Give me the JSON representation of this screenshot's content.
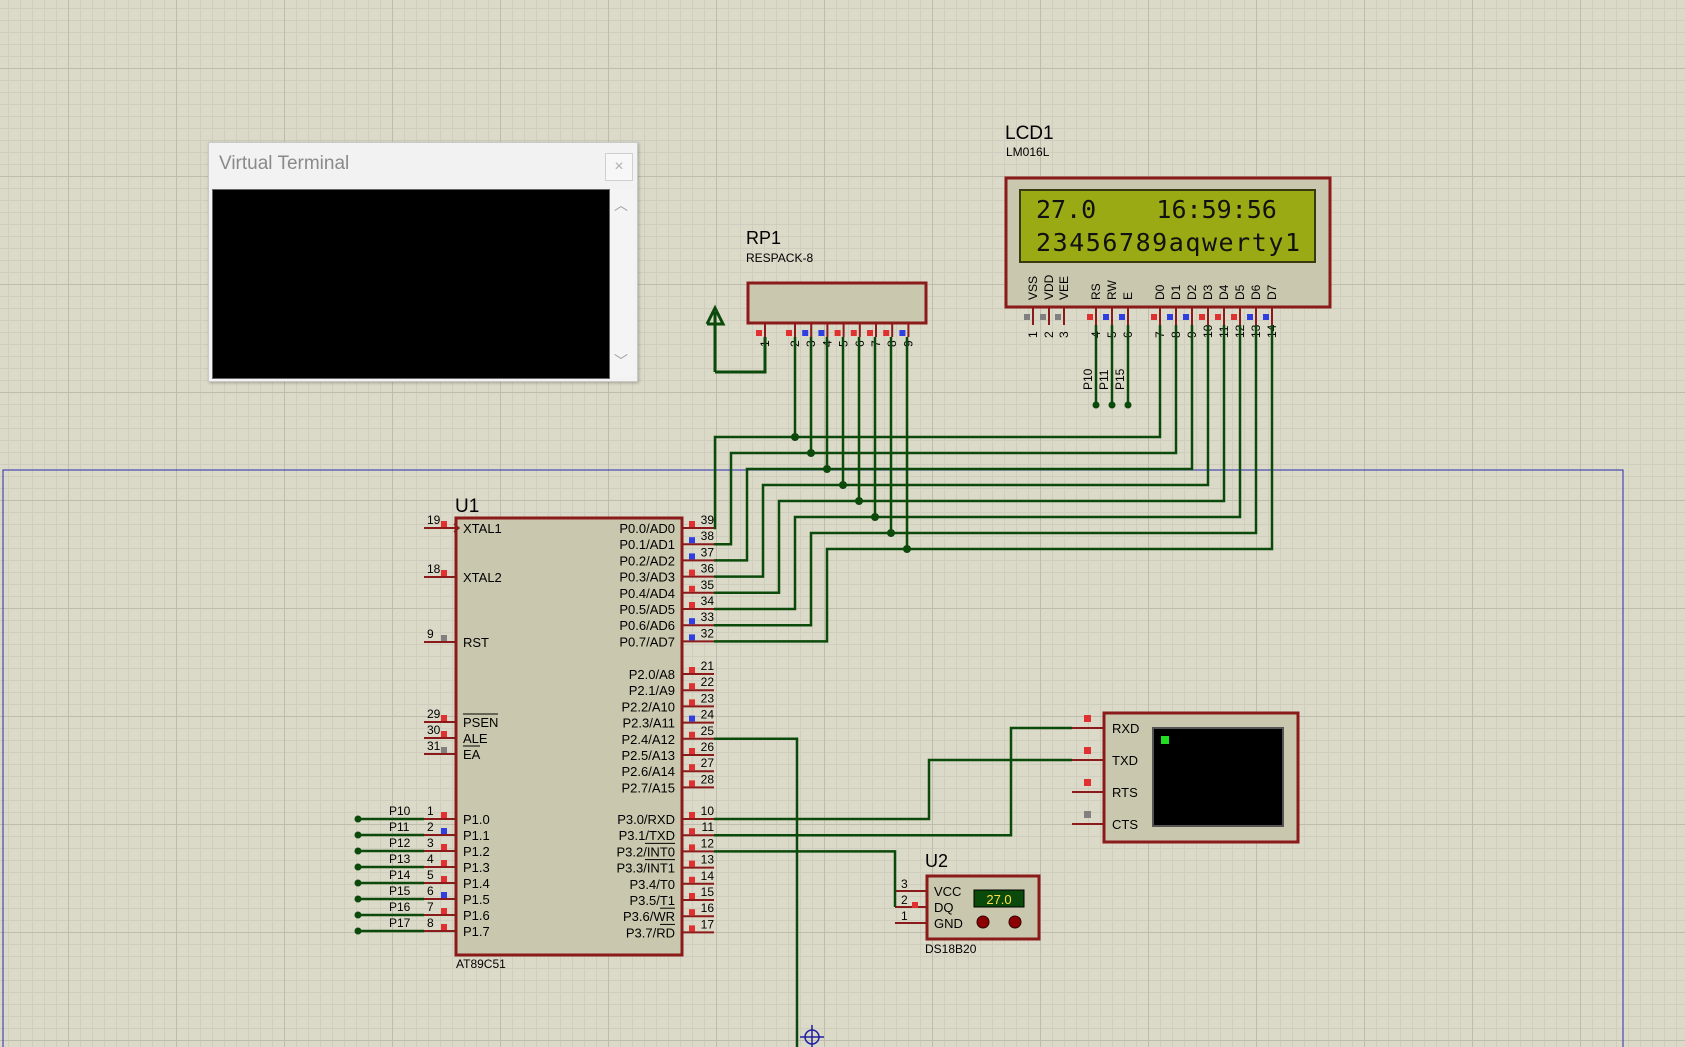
{
  "terminal_window": {
    "title": "Virtual Terminal",
    "close": "×",
    "scroll_up": "︿",
    "scroll_down": "﹀"
  },
  "lcd": {
    "ref": "LCD1",
    "part": "LM016L",
    "line1": "27.0    16:59:56",
    "line2": "23456789aqwerty1",
    "pins": [
      "VSS",
      "VDD",
      "VEE",
      "RS",
      "RW",
      "E",
      "D0",
      "D1",
      "D2",
      "D3",
      "D4",
      "D5",
      "D6",
      "D7"
    ],
    "pin_numbers": [
      "1",
      "2",
      "3",
      "4",
      "5",
      "6",
      "7",
      "8",
      "9",
      "10",
      "11",
      "12",
      "13",
      "14"
    ],
    "ctrl_nets": [
      "P10",
      "P11",
      "P15"
    ]
  },
  "rp1": {
    "ref": "RP1",
    "part": "RESPACK-8",
    "pin_numbers": [
      "1",
      "2",
      "3",
      "4",
      "5",
      "6",
      "7",
      "8",
      "9"
    ]
  },
  "u1": {
    "ref": "U1",
    "part": "AT89C51",
    "left_pins": [
      {
        "num": "19",
        "name": "XTAL1"
      },
      {
        "num": "18",
        "name": "XTAL2"
      },
      {
        "num": "9",
        "name": "RST"
      },
      {
        "num": "29",
        "name": "PSEN"
      },
      {
        "num": "30",
        "name": "ALE"
      },
      {
        "num": "31",
        "name": "EA"
      },
      {
        "num": "1",
        "name": "P1.0",
        "net": "P10"
      },
      {
        "num": "2",
        "name": "P1.1",
        "net": "P11"
      },
      {
        "num": "3",
        "name": "P1.2",
        "net": "P12"
      },
      {
        "num": "4",
        "name": "P1.3",
        "net": "P13"
      },
      {
        "num": "5",
        "name": "P1.4",
        "net": "P14"
      },
      {
        "num": "6",
        "name": "P1.5",
        "net": "P15"
      },
      {
        "num": "7",
        "name": "P1.6",
        "net": "P16"
      },
      {
        "num": "8",
        "name": "P1.7",
        "net": "P17"
      }
    ],
    "right_pins": [
      {
        "num": "39",
        "name": "P0.0/AD0"
      },
      {
        "num": "38",
        "name": "P0.1/AD1"
      },
      {
        "num": "37",
        "name": "P0.2/AD2"
      },
      {
        "num": "36",
        "name": "P0.3/AD3"
      },
      {
        "num": "35",
        "name": "P0.4/AD4"
      },
      {
        "num": "34",
        "name": "P0.5/AD5"
      },
      {
        "num": "33",
        "name": "P0.6/AD6"
      },
      {
        "num": "32",
        "name": "P0.7/AD7"
      },
      {
        "num": "21",
        "name": "P2.0/A8"
      },
      {
        "num": "22",
        "name": "P2.1/A9"
      },
      {
        "num": "23",
        "name": "P2.2/A10"
      },
      {
        "num": "24",
        "name": "P2.3/A11"
      },
      {
        "num": "25",
        "name": "P2.4/A12"
      },
      {
        "num": "26",
        "name": "P2.5/A13"
      },
      {
        "num": "27",
        "name": "P2.6/A14"
      },
      {
        "num": "28",
        "name": "P2.7/A15"
      },
      {
        "num": "10",
        "name": "P3.0/RXD"
      },
      {
        "num": "11",
        "name": "P3.1/TXD"
      },
      {
        "num": "12",
        "name": "P3.2/INT0"
      },
      {
        "num": "13",
        "name": "P3.3/INT1"
      },
      {
        "num": "14",
        "name": "P3.4/T0"
      },
      {
        "num": "15",
        "name": "P3.5/T1"
      },
      {
        "num": "16",
        "name": "P3.6/WR"
      },
      {
        "num": "17",
        "name": "P3.7/RD"
      }
    ]
  },
  "vt_device": {
    "pins": [
      "RXD",
      "TXD",
      "RTS",
      "CTS"
    ]
  },
  "u2": {
    "ref": "U2",
    "part": "DS18B20",
    "display": "27.0",
    "pins": [
      {
        "num": "3",
        "name": "VCC"
      },
      {
        "num": "2",
        "name": "DQ"
      },
      {
        "num": "1",
        "name": "GND"
      }
    ]
  },
  "colors": {
    "wire": "#0b4a0b",
    "body_fill": "#c9c7ae",
    "body_stroke": "#8b1a1a",
    "pin_red": "#e03030",
    "pin_blue": "#3040e0",
    "lcd_bg": "#9aaa14"
  }
}
